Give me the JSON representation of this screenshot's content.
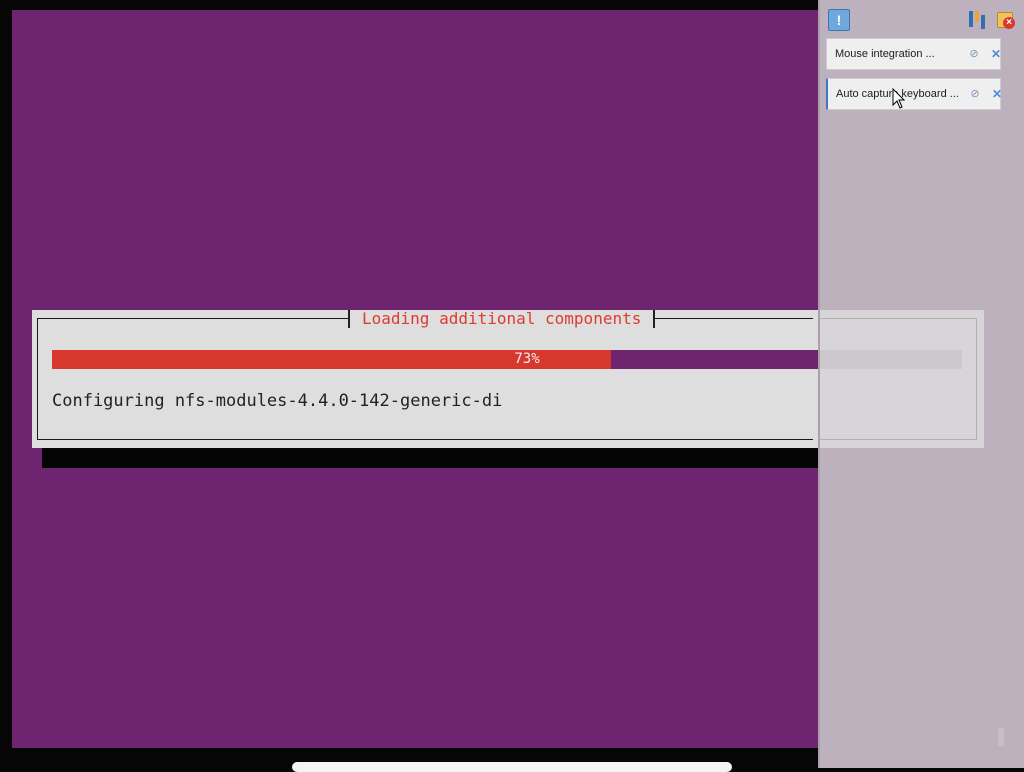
{
  "installer": {
    "dialog_title": "Loading additional components",
    "progress_percent": 73,
    "progress_label": "73%",
    "status": "Configuring nfs-modules-4.4.0-142-generic-di"
  },
  "notification_center": {
    "toolbar": {
      "bell_icon": "exclamation-bubble-icon",
      "sort_icon": "sort-icon",
      "close_all_icon": "close-all-icon"
    },
    "items": [
      {
        "label": "Mouse integration ...",
        "pin_icon": "pin-icon",
        "close_icon": "close-icon"
      },
      {
        "label": "Auto capture keyboard ...",
        "pin_icon": "pin-icon",
        "close_icon": "close-icon"
      }
    ]
  },
  "colors": {
    "desktop": "#6f2470",
    "progress_fill": "#d6382c",
    "title_text": "#dd3b30",
    "panel_bg": "#bcb1bc",
    "accent": "#3b78c5"
  }
}
